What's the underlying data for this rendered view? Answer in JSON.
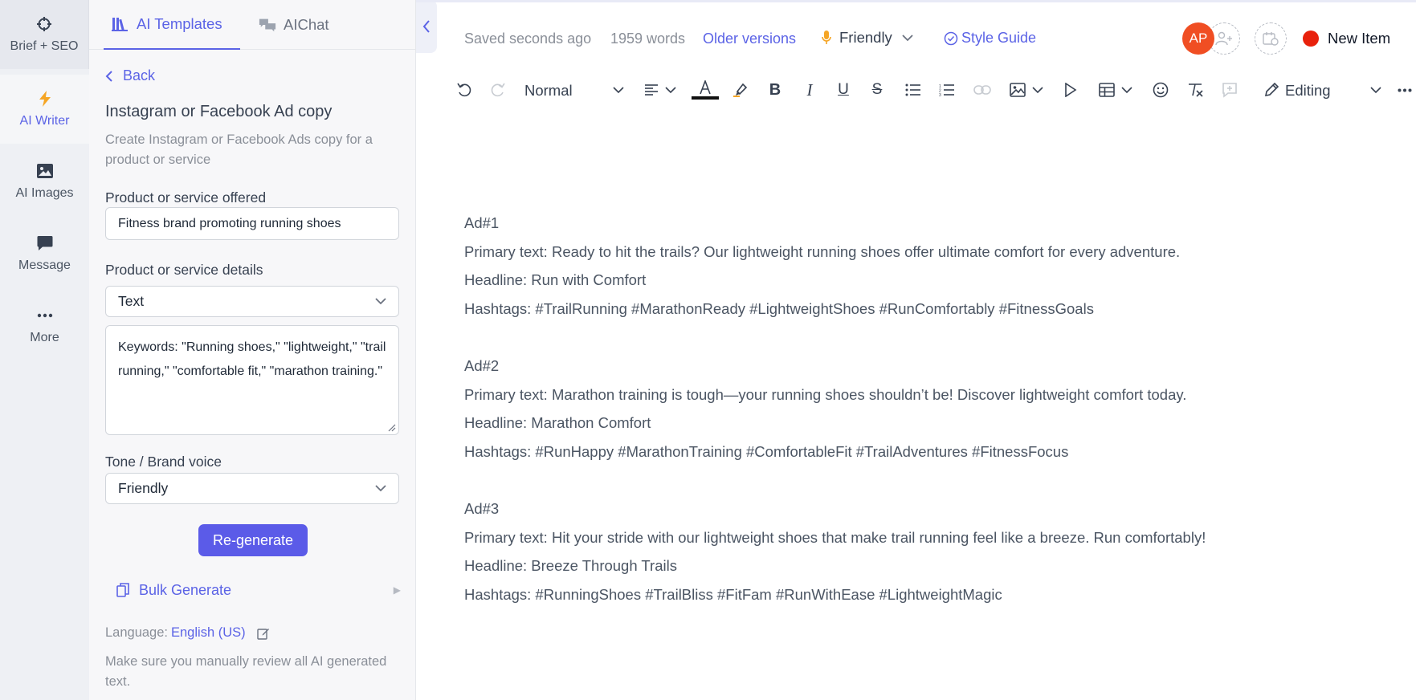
{
  "rail": {
    "items": [
      {
        "label": "Brief + SEO",
        "icon": "crosshair-icon"
      },
      {
        "label": "AI Writer",
        "icon": "lightning-icon"
      },
      {
        "label": "AI Images",
        "icon": "image-icon"
      },
      {
        "label": "Message",
        "icon": "message-icon"
      },
      {
        "label": "More",
        "icon": "more-dots-icon"
      }
    ]
  },
  "panel": {
    "tabs": [
      {
        "label": "AI Templates",
        "icon": "library-icon",
        "active": true
      },
      {
        "label": "AIChat",
        "icon": "chat-bubbles-icon",
        "active": false
      }
    ],
    "back_label": "Back",
    "title": "Instagram or Facebook Ad copy",
    "description": "Create Instagram or Facebook Ads copy for a product or service",
    "product_label": "Product or service offered",
    "product_value": "Fitness brand promoting running shoes",
    "details_label": "Product or service details",
    "details_type": "Text",
    "details_value": "Keywords: \"Running shoes,\" \"lightweight,\" \"trail running,\" \"comfortable fit,\" \"marathon training.\"",
    "tone_label": "Tone / Brand voice",
    "tone_value": "Friendly",
    "regenerate_label": "Re-generate",
    "bulk_label": "Bulk Generate",
    "language_label": "Language:",
    "language_value": "English (US)",
    "note": "Make sure you manually review all AI generated text."
  },
  "topbar": {
    "saved": "Saved seconds ago",
    "words": "1959 words",
    "older_versions": "Older versions",
    "tone": "Friendly",
    "style_guide": "Style Guide",
    "avatar_initials": "AP",
    "new_item": "New Item",
    "colors": {
      "accent": "#5b63e6",
      "avatar": "#f04e23",
      "new_item_dot": "#e8210c"
    }
  },
  "toolbar": {
    "block_style": "Normal",
    "mode": "Editing"
  },
  "document": {
    "ads": [
      {
        "heading": "Ad#1",
        "primary": "Primary text: Ready to hit the trails? Our lightweight running shoes offer ultimate comfort for every adventure.",
        "headline": "Headline: Run with Comfort",
        "hashtags": "Hashtags: #TrailRunning #MarathonReady #LightweightShoes #RunComfortably #FitnessGoals"
      },
      {
        "heading": "Ad#2",
        "primary": "Primary text: Marathon training is tough—your running shoes shouldn’t be! Discover lightweight comfort today.",
        "headline": "Headline: Marathon Comfort",
        "hashtags": "Hashtags: #RunHappy #MarathonTraining #ComfortableFit #TrailAdventures #FitnessFocus"
      },
      {
        "heading": "Ad#3",
        "primary": "Primary text: Hit your stride with our lightweight shoes that make trail running feel like a breeze. Run comfortably!",
        "headline": "Headline: Breeze Through Trails",
        "hashtags": "Hashtags: #RunningShoes #TrailBliss #FitFam #RunWithEase #LightweightMagic"
      }
    ]
  }
}
